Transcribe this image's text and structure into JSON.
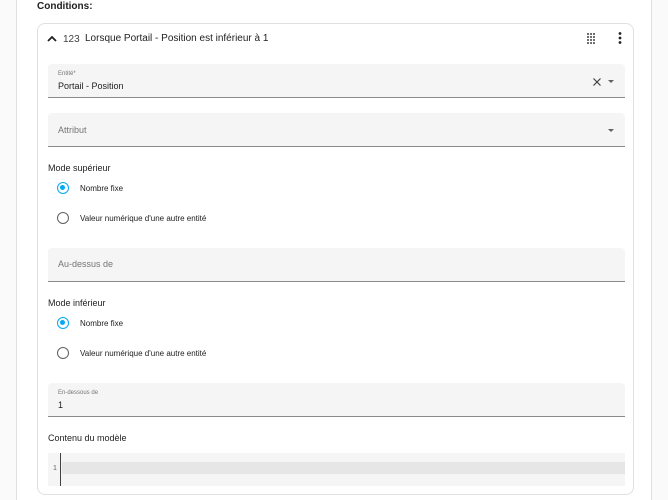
{
  "conditions": {
    "heading": "Conditions:"
  },
  "condition": {
    "type_icon": "123",
    "title": "Lorsque Portail - Position est inférieur à 1",
    "icons": {
      "collapse": "chevron-up-icon",
      "drag": "drag-handle-icon",
      "menu": "more-vertical-icon"
    }
  },
  "entity": {
    "label": "Entité*",
    "value": "Portail - Position"
  },
  "attribute": {
    "placeholder": "Attribut"
  },
  "above_mode": {
    "label": "Mode supérieur",
    "options": [
      "Nombre fixe",
      "Valeur numérique d'une autre entité"
    ],
    "selected": 0
  },
  "above": {
    "placeholder": "Au-dessus de"
  },
  "below_mode": {
    "label": "Mode inférieur",
    "options": [
      "Nombre fixe",
      "Valeur numérique d'une autre entité"
    ],
    "selected": 0
  },
  "below": {
    "label": "En-dessous de",
    "value": "1"
  },
  "template": {
    "label": "Contenu du modèle",
    "line_number": "1",
    "content": ""
  },
  "colors": {
    "accent": "#03a9f4",
    "field_bg": "#f5f5f5"
  }
}
